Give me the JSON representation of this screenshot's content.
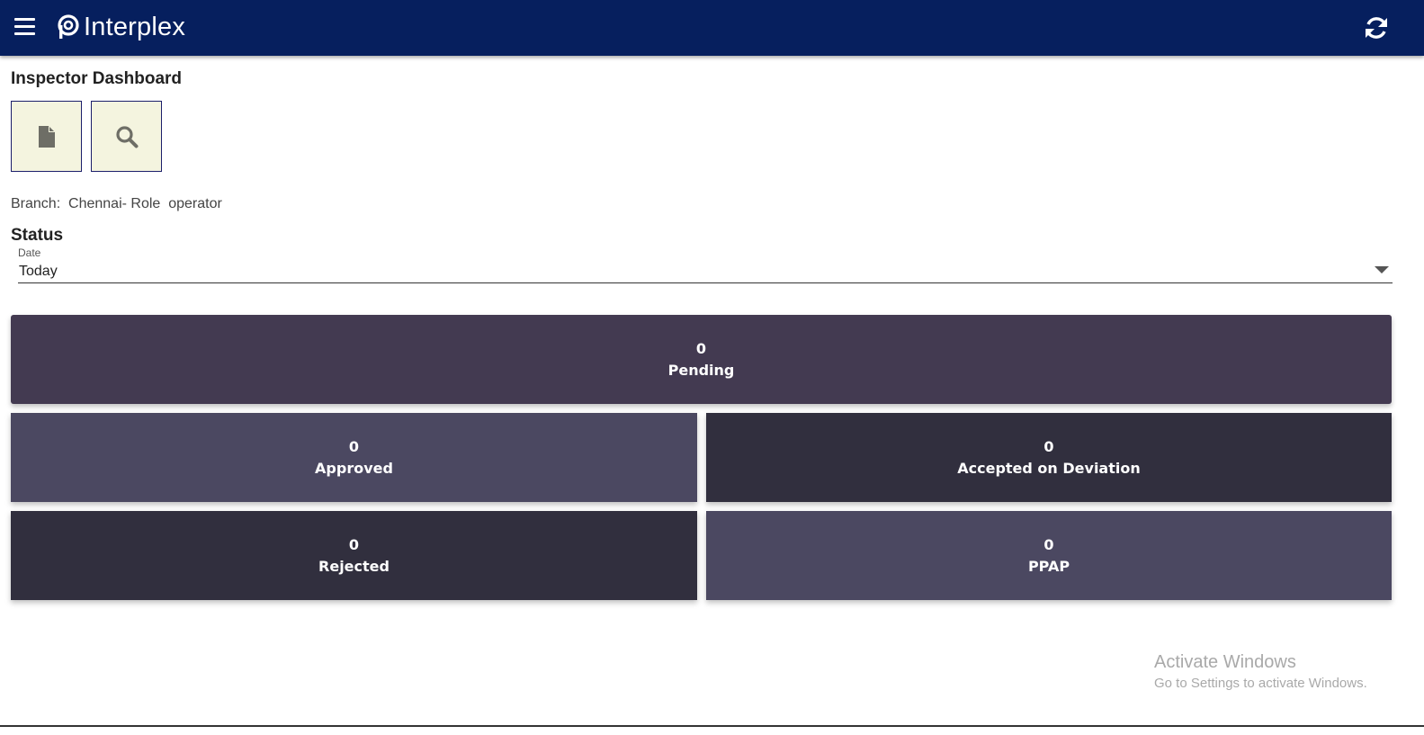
{
  "app": {
    "brand": "Interplex",
    "colors": {
      "header": "#061f5e",
      "tool_button_bg": "#f4f4df"
    }
  },
  "icons": {
    "menu": "hamburger-menu-icon",
    "logo": "interplex-logo-icon",
    "refresh": "refresh-icon",
    "document": "document-icon",
    "search": "search-icon",
    "dropdown": "dropdown-arrow-icon"
  },
  "page": {
    "title": "Inspector Dashboard"
  },
  "branch_info": {
    "text": "Branch:  Chennai- Role  operator"
  },
  "status": {
    "heading": "Status",
    "date_label": "Date",
    "date_value": "Today"
  },
  "cards": {
    "pending": {
      "count": "0",
      "label": "Pending",
      "color": "#433a51"
    },
    "approved": {
      "count": "0",
      "label": "Approved",
      "color": "#4b4861"
    },
    "accepted_on_deviation": {
      "count": "0",
      "label": "Accepted on Deviation",
      "color": "#312f3e"
    },
    "rejected": {
      "count": "0",
      "label": "Rejected",
      "color": "#312f3e"
    },
    "ppap": {
      "count": "0",
      "label": "PPAP",
      "color": "#4b4861"
    }
  },
  "watermark": {
    "title": "Activate Windows",
    "subtitle": "Go to Settings to activate Windows."
  }
}
